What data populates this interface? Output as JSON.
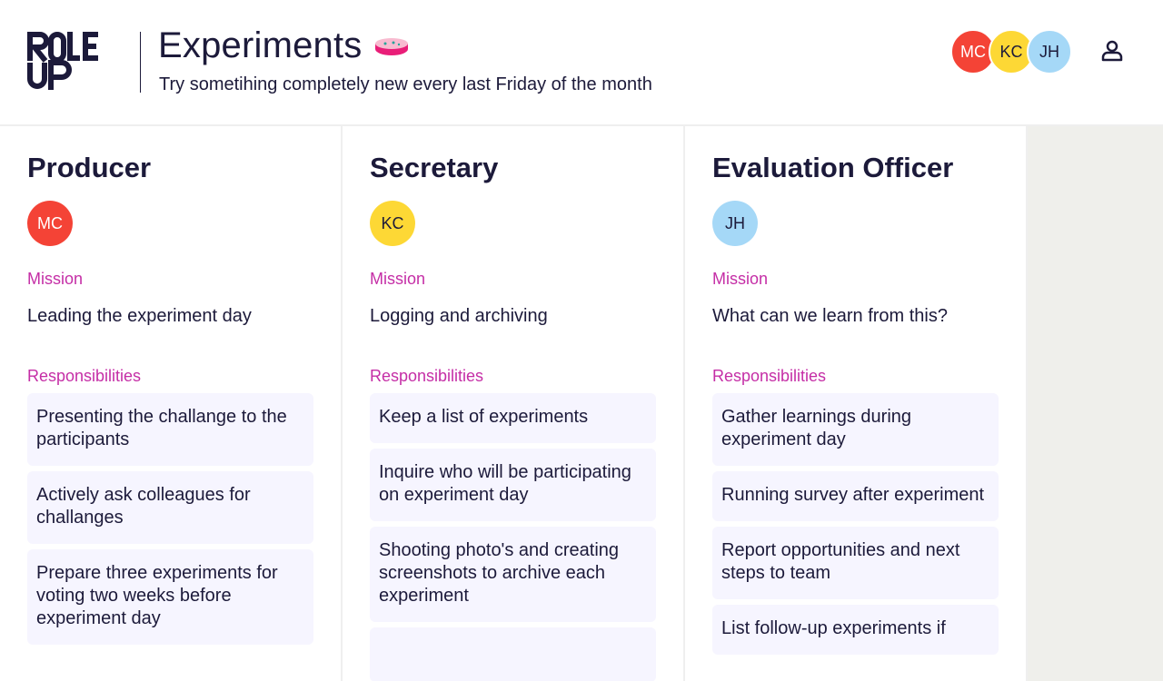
{
  "header": {
    "logo_alt": "ROLE UP",
    "title": "Experiments",
    "title_emoji": "petri-dish",
    "subtitle": "Try sometihing completely new every last Friday of the month",
    "avatars": [
      {
        "initials": "MC",
        "color": "#f44336",
        "text_color": "#ffffff"
      },
      {
        "initials": "KC",
        "color": "#fdd835",
        "text_color": "#1c1a3a"
      },
      {
        "initials": "JH",
        "color": "#a5d8f7",
        "text_color": "#1c1a3a"
      }
    ],
    "user_icon": "user-icon"
  },
  "roles": [
    {
      "title": "Producer",
      "avatar": {
        "initials": "MC",
        "color": "#f44336",
        "text_color": "#ffffff"
      },
      "mission_label": "Mission",
      "mission": "Leading the experiment day",
      "responsibilities_label": "Responsibilities",
      "responsibilities": [
        "Presenting the challange to the participants",
        "Actively ask colleagues for challanges",
        "Prepare three experiments for voting two weeks before experiment day"
      ]
    },
    {
      "title": "Secretary",
      "avatar": {
        "initials": "KC",
        "color": "#fdd835",
        "text_color": "#1c1a3a"
      },
      "mission_label": "Mission",
      "mission": "Logging and archiving",
      "responsibilities_label": "Responsibilities",
      "responsibilities": [
        "Keep a list of experiments",
        "Inquire who will be participating on experiment day",
        "Shooting photo's and creating screenshots to archive each experiment",
        ""
      ]
    },
    {
      "title": "Evaluation Officer",
      "avatar": {
        "initials": "JH",
        "color": "#a5d8f7",
        "text_color": "#1c1a3a"
      },
      "mission_label": "Mission",
      "mission": "What can we learn from this?",
      "responsibilities_label": "Responsibilities",
      "responsibilities": [
        "Gather learnings during experiment day",
        "Running survey after experiment",
        "Report opportunities and next steps to team",
        "List follow-up experiments if"
      ]
    }
  ]
}
